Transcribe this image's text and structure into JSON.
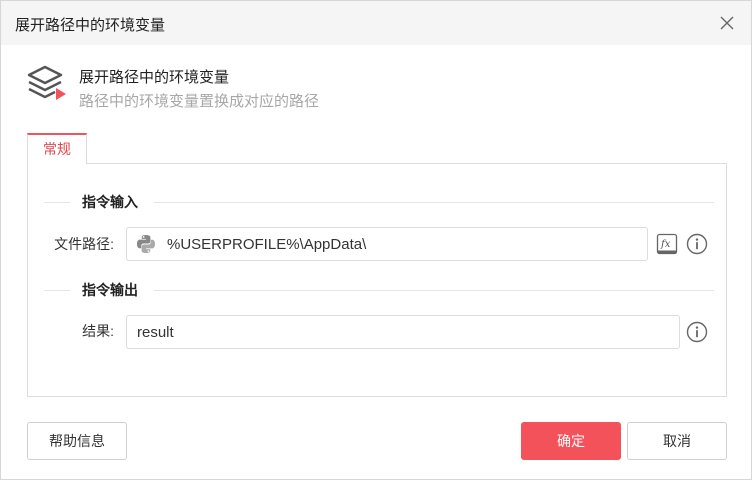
{
  "window": {
    "title": "展开路径中的环境变量"
  },
  "header": {
    "title": "展开路径中的环境变量",
    "subtitle": "路径中的环境变量置换成对应的路径"
  },
  "tabs": [
    {
      "label": "常规",
      "active": true
    }
  ],
  "input_section": {
    "heading": "指令输入",
    "file_path": {
      "label": "文件路径:",
      "value": "%USERPROFILE%\\AppData\\"
    }
  },
  "output_section": {
    "heading": "指令输出",
    "result": {
      "label": "结果:",
      "value": "result"
    }
  },
  "footer": {
    "help_label": "帮助信息",
    "ok_label": "确定",
    "cancel_label": "取消"
  },
  "colors": {
    "accent": "#f4525b",
    "tab_text": "#e2474f",
    "subtitle": "#a8a8a8"
  }
}
